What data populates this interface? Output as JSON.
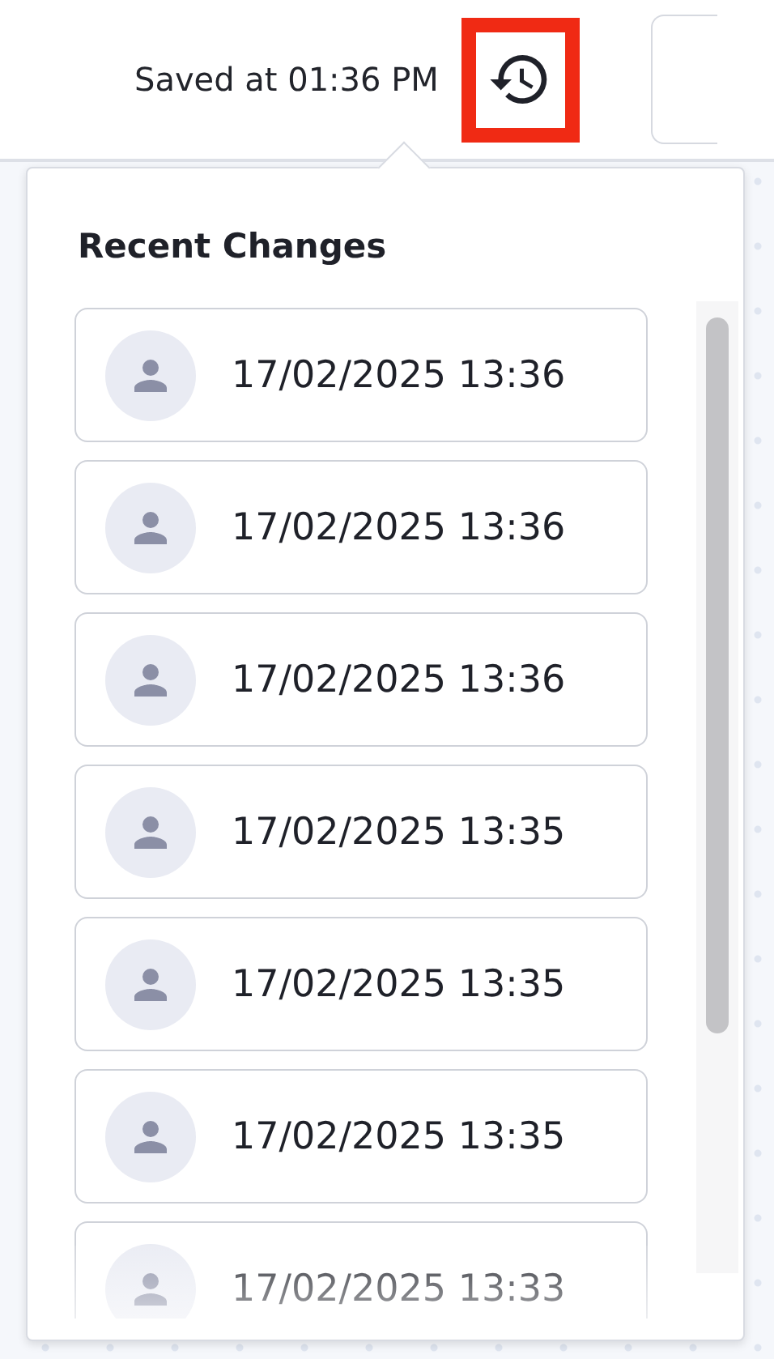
{
  "header": {
    "save_status": "Saved at 01:36 PM"
  },
  "recent_changes": {
    "title": "Recent Changes",
    "items": [
      {
        "timestamp": "17/02/2025 13:36"
      },
      {
        "timestamp": "17/02/2025 13:36"
      },
      {
        "timestamp": "17/02/2025 13:36"
      },
      {
        "timestamp": "17/02/2025 13:35"
      },
      {
        "timestamp": "17/02/2025 13:35"
      },
      {
        "timestamp": "17/02/2025 13:35"
      },
      {
        "timestamp": "17/02/2025 13:33"
      }
    ]
  }
}
